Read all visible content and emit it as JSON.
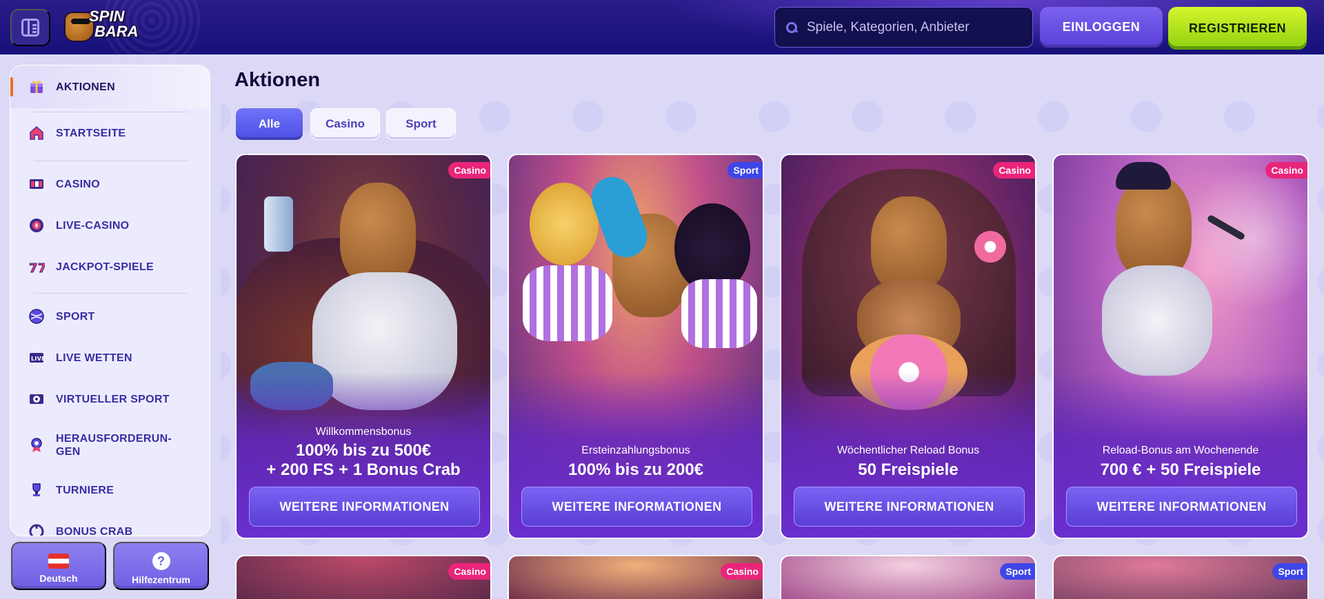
{
  "header": {
    "logo_text_top": "SPIN",
    "logo_text_bottom": "BARA",
    "search_placeholder": "Spiele, Kategorien, Anbieter",
    "login_label": "EINLOGGEN",
    "register_label": "REGISTRIEREN"
  },
  "sidebar": {
    "items": [
      {
        "label": "AKTIONEN",
        "icon": "promotions-icon",
        "active": true
      },
      {
        "label": "STARTSEITE",
        "icon": "home-icon"
      },
      {
        "label": "CASINO",
        "icon": "casino-icon"
      },
      {
        "label": "LIVE-CASINO",
        "icon": "live-casino-icon"
      },
      {
        "label": "JACKPOT-SPIELE",
        "icon": "jackpot-icon"
      },
      {
        "label": "SPORT",
        "icon": "sport-ball-icon"
      },
      {
        "label": "LIVE WETTEN",
        "icon": "live-bets-icon"
      },
      {
        "label": "VIRTUELLER SPORT",
        "icon": "virtual-sport-icon"
      },
      {
        "label": "HERAUSFORDERUN-GEN",
        "icon": "challenges-icon"
      },
      {
        "label": "TURNIERE",
        "icon": "trophy-icon"
      },
      {
        "label": "BONUS CRAB",
        "icon": "bonus-crab-icon"
      }
    ],
    "language_label": "Deutsch",
    "help_label": "Hilfezentrum",
    "help_glyph": "?"
  },
  "main": {
    "title": "Aktionen",
    "filters": [
      "Alle",
      "Casino",
      "Sport"
    ],
    "active_filter": "Alle",
    "cards": [
      {
        "tag": "Casino",
        "subtitle": "Willkommensbonus",
        "headline_1": "100% bis zu 500€",
        "headline_2": "+ 200 FS + 1 Bonus Crab",
        "button": "WEITERE INFORMATIONEN"
      },
      {
        "tag": "Sport",
        "subtitle": "Ersteinzahlungsbonus",
        "headline_1": "100% bis zu 200€",
        "headline_2": "",
        "button": "WEITERE INFORMATIONEN"
      },
      {
        "tag": "Casino",
        "subtitle": "Wöchentlicher Reload Bonus",
        "headline_1": "50 Freispiele",
        "headline_2": "",
        "button": "WEITERE INFORMATIONEN"
      },
      {
        "tag": "Casino",
        "subtitle": "Reload-Bonus am Wochenende",
        "headline_1": "700 € + 50 Freispiele",
        "headline_2": "",
        "button": "WEITERE INFORMATIONEN"
      }
    ],
    "next_row_tags": [
      "Casino",
      "Casino",
      "Sport",
      "Sport"
    ]
  },
  "colors": {
    "header_bg": "#17117a",
    "register_green": "#b9ea1e",
    "login_purple": "#6a50e3",
    "casino_tag": "#e9257a",
    "sport_tag": "#3f46e8",
    "sidebar_text": "#3a2ca3",
    "active_accent": "#f36a1c"
  }
}
